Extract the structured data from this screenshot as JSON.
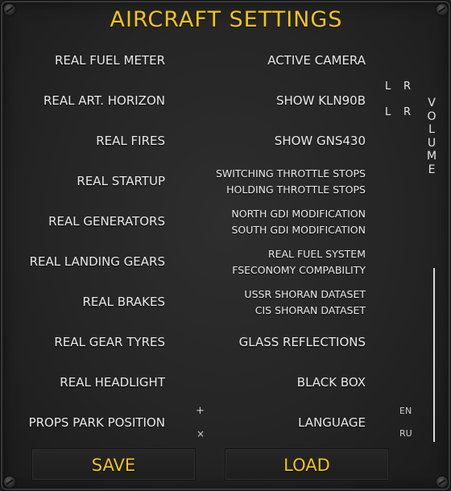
{
  "title": "AIRCRAFT SETTINGS",
  "left_options": [
    "REAL FUEL METER",
    "REAL ART. HORIZON",
    "REAL FIRES",
    "REAL STARTUP",
    "REAL GENERATORS",
    "REAL LANDING GEARS",
    "REAL BRAKES",
    "REAL GEAR TYRES",
    "REAL HEADLIGHT",
    "PROPS PARK POSITION"
  ],
  "right_options": {
    "active_camera": "ACTIVE CAMERA",
    "show_kln90b": "SHOW KLN90B",
    "show_gns430": "SHOW GNS430",
    "throttle_top": "SWITCHING THROTTLE STOPS",
    "throttle_bottom": "HOLDING THROTTLE STOPS",
    "gdi_top": "NORTH GDI MODIFICATION",
    "gdi_bottom": "SOUTH GDI MODIFICATION",
    "fuel_top": "REAL FUEL SYSTEM",
    "fuel_bottom": "FSECONOMY COMPABILITY",
    "shoran_top": "USSR SHORAN DATASET",
    "shoran_bottom": "CIS SHORAN DATASET",
    "glass": "GLASS REFLECTIONS",
    "black_box": "BLACK BOX",
    "language": "LANGUAGE"
  },
  "props_park": {
    "plus": "+",
    "cross": "×"
  },
  "language_options": {
    "en": "EN",
    "ru": "RU"
  },
  "volume": {
    "label": "VOLUME",
    "row1_l": "L",
    "row1_r": "R",
    "row2_l": "L",
    "row2_r": "R"
  },
  "buttons": {
    "save": "SAVE",
    "load": "LOAD"
  },
  "colors": {
    "accent": "#f2c51c",
    "text": "#ececec",
    "panel": "#282828"
  }
}
